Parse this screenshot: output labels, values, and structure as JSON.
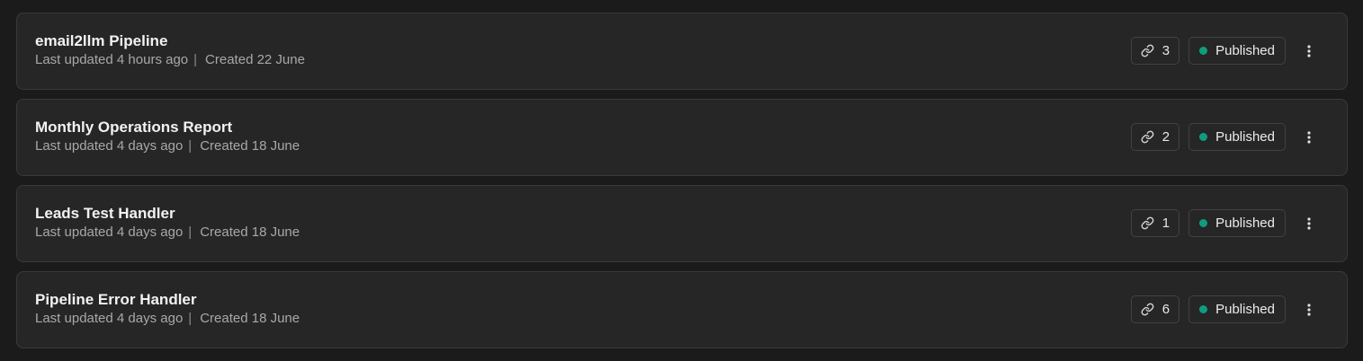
{
  "colors": {
    "published_dot": "#0f9d7e"
  },
  "workflows": [
    {
      "title": "email2llm Pipeline",
      "updated": "Last updated 4 hours ago",
      "separator": "|",
      "created": "Created 22 June",
      "link_count": "3",
      "status": "Published"
    },
    {
      "title": "Monthly Operations Report",
      "updated": "Last updated 4 days ago",
      "separator": "|",
      "created": "Created 18 June",
      "link_count": "2",
      "status": "Published"
    },
    {
      "title": "Leads Test Handler",
      "updated": "Last updated 4 days ago",
      "separator": "|",
      "created": "Created 18 June",
      "link_count": "1",
      "status": "Published"
    },
    {
      "title": "Pipeline Error Handler",
      "updated": "Last updated 4 days ago",
      "separator": "|",
      "created": "Created 18 June",
      "link_count": "6",
      "status": "Published"
    }
  ]
}
